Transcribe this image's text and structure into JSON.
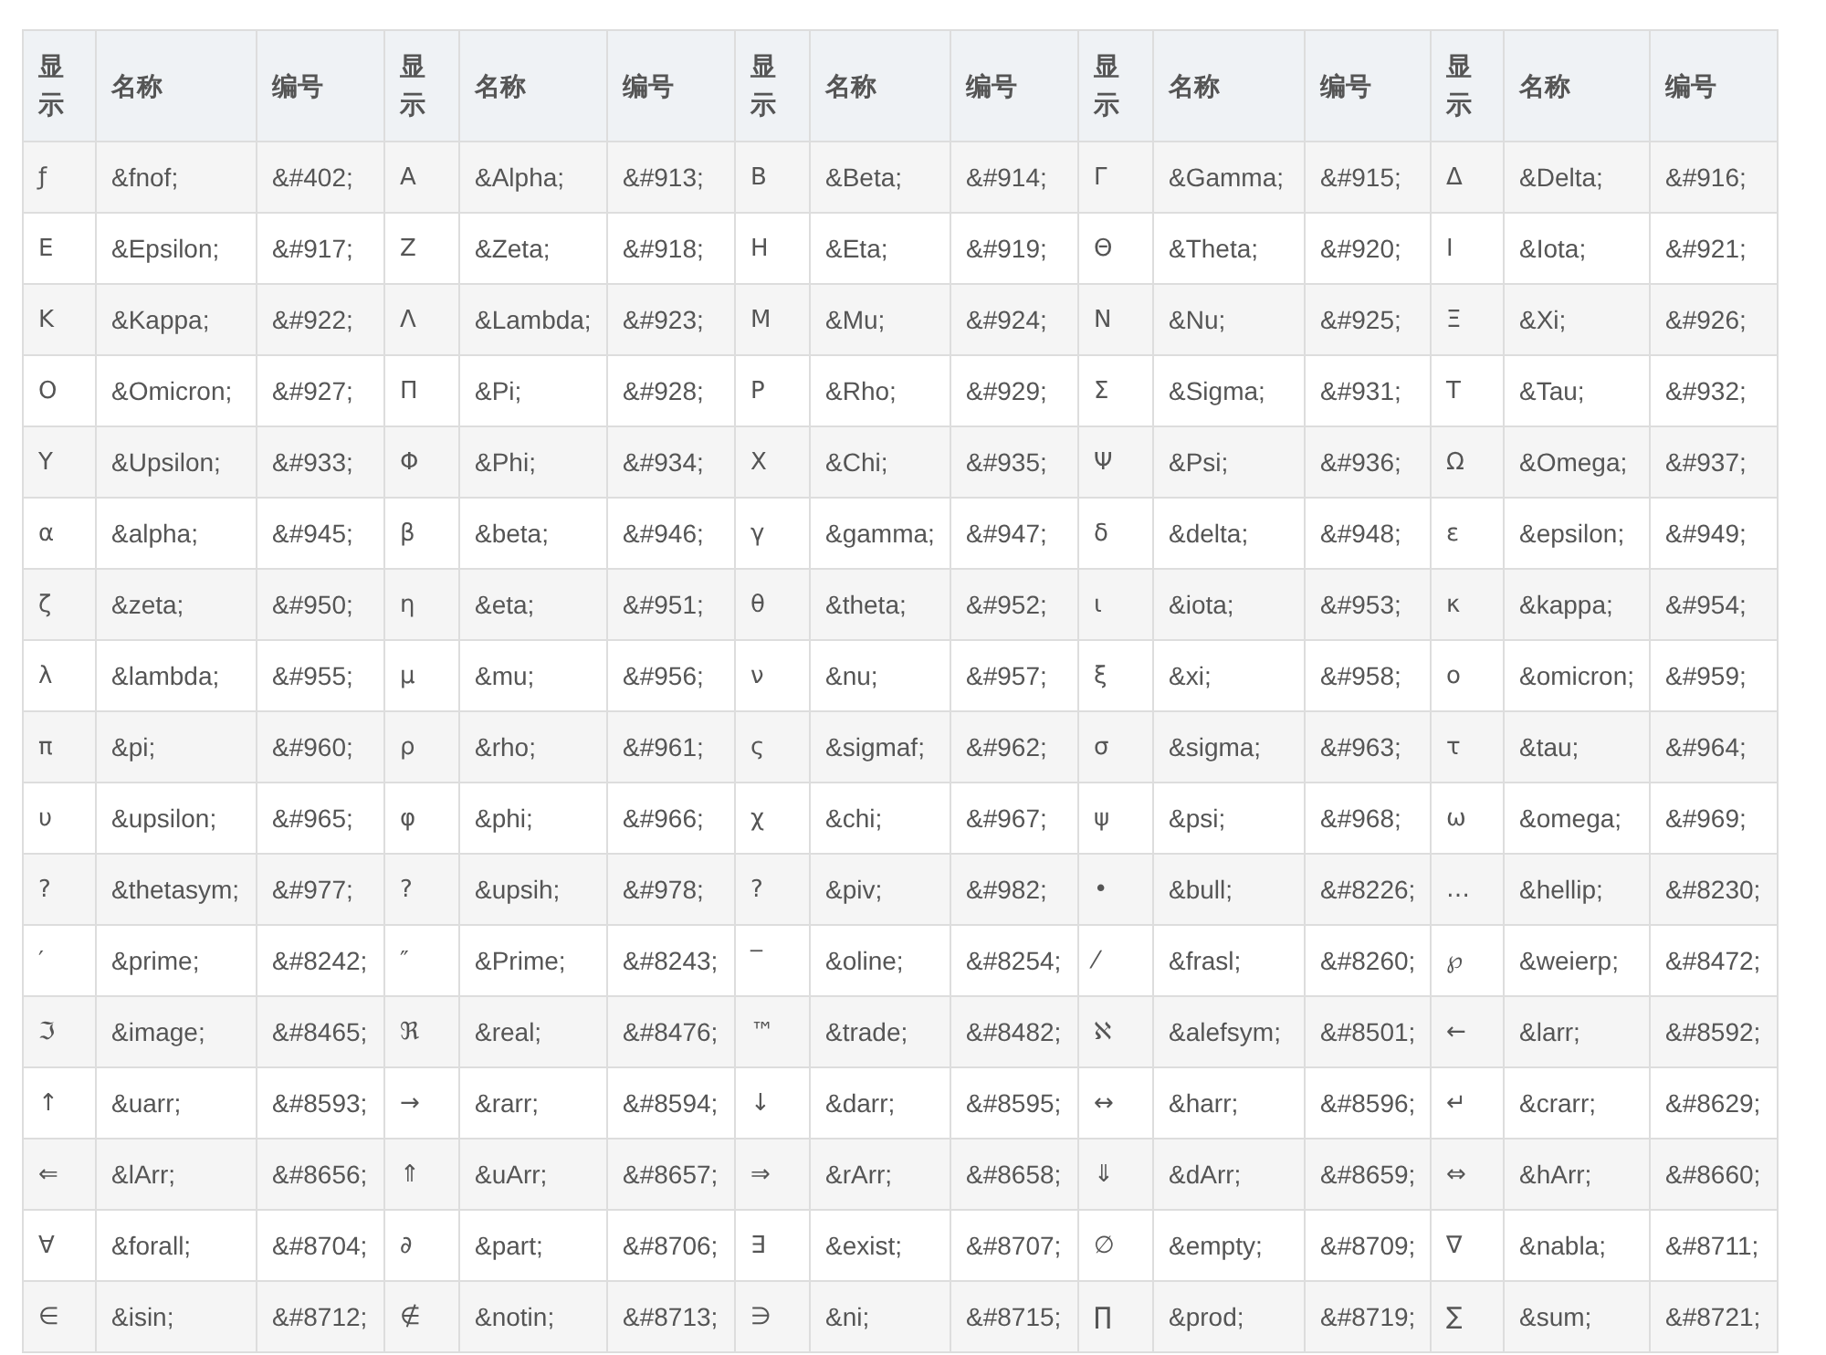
{
  "table": {
    "columns": [
      "显示",
      "名称",
      "编号",
      "显示",
      "名称",
      "编号",
      "显示",
      "名称",
      "编号",
      "显示",
      "名称",
      "编号",
      "显示",
      "名称",
      "编号"
    ],
    "rows": [
      [
        "ƒ",
        "&fnof;",
        "&#402;",
        "Α",
        "&Alpha;",
        "&#913;",
        "Β",
        "&Beta;",
        "&#914;",
        "Γ",
        "&Gamma;",
        "&#915;",
        "Δ",
        "&Delta;",
        "&#916;"
      ],
      [
        "Ε",
        "&Epsilon;",
        "&#917;",
        "Ζ",
        "&Zeta;",
        "&#918;",
        "Η",
        "&Eta;",
        "&#919;",
        "Θ",
        "&Theta;",
        "&#920;",
        "Ι",
        "&Iota;",
        "&#921;"
      ],
      [
        "Κ",
        "&Kappa;",
        "&#922;",
        "Λ",
        "&Lambda;",
        "&#923;",
        "Μ",
        "&Mu;",
        "&#924;",
        "Ν",
        "&Nu;",
        "&#925;",
        "Ξ",
        "&Xi;",
        "&#926;"
      ],
      [
        "Ο",
        "&Omicron;",
        "&#927;",
        "Π",
        "&Pi;",
        "&#928;",
        "Ρ",
        "&Rho;",
        "&#929;",
        "Σ",
        "&Sigma;",
        "&#931;",
        "Τ",
        "&Tau;",
        "&#932;"
      ],
      [
        "Υ",
        "&Upsilon;",
        "&#933;",
        "Φ",
        "&Phi;",
        "&#934;",
        "Χ",
        "&Chi;",
        "&#935;",
        "Ψ",
        "&Psi;",
        "&#936;",
        "Ω",
        "&Omega;",
        "&#937;"
      ],
      [
        "α",
        "&alpha;",
        "&#945;",
        "β",
        "&beta;",
        "&#946;",
        "γ",
        "&gamma;",
        "&#947;",
        "δ",
        "&delta;",
        "&#948;",
        "ε",
        "&epsilon;",
        "&#949;"
      ],
      [
        "ζ",
        "&zeta;",
        "&#950;",
        "η",
        "&eta;",
        "&#951;",
        "θ",
        "&theta;",
        "&#952;",
        "ι",
        "&iota;",
        "&#953;",
        "κ",
        "&kappa;",
        "&#954;"
      ],
      [
        "λ",
        "&lambda;",
        "&#955;",
        "μ",
        "&mu;",
        "&#956;",
        "ν",
        "&nu;",
        "&#957;",
        "ξ",
        "&xi;",
        "&#958;",
        "ο",
        "&omicron;",
        "&#959;"
      ],
      [
        "π",
        "&pi;",
        "&#960;",
        "ρ",
        "&rho;",
        "&#961;",
        "ς",
        "&sigmaf;",
        "&#962;",
        "σ",
        "&sigma;",
        "&#963;",
        "τ",
        "&tau;",
        "&#964;"
      ],
      [
        "υ",
        "&upsilon;",
        "&#965;",
        "φ",
        "&phi;",
        "&#966;",
        "χ",
        "&chi;",
        "&#967;",
        "ψ",
        "&psi;",
        "&#968;",
        "ω",
        "&omega;",
        "&#969;"
      ],
      [
        "?",
        "&thetasym;",
        "&#977;",
        "?",
        "&upsih;",
        "&#978;",
        "?",
        "&piv;",
        "&#982;",
        "•",
        "&bull;",
        "&#8226;",
        "…",
        "&hellip;",
        "&#8230;"
      ],
      [
        "′",
        "&prime;",
        "&#8242;",
        "″",
        "&Prime;",
        "&#8243;",
        "‾",
        "&oline;",
        "&#8254;",
        "⁄",
        "&frasl;",
        "&#8260;",
        "℘",
        "&weierp;",
        "&#8472;"
      ],
      [
        "ℑ",
        "&image;",
        "&#8465;",
        "ℜ",
        "&real;",
        "&#8476;",
        "™",
        "&trade;",
        "&#8482;",
        "ℵ",
        "&alefsym;",
        "&#8501;",
        "←",
        "&larr;",
        "&#8592;"
      ],
      [
        "↑",
        "&uarr;",
        "&#8593;",
        "→",
        "&rarr;",
        "&#8594;",
        "↓",
        "&darr;",
        "&#8595;",
        "↔",
        "&harr;",
        "&#8596;",
        "↵",
        "&crarr;",
        "&#8629;"
      ],
      [
        "⇐",
        "&lArr;",
        "&#8656;",
        "⇑",
        "&uArr;",
        "&#8657;",
        "⇒",
        "&rArr;",
        "&#8658;",
        "⇓",
        "&dArr;",
        "&#8659;",
        "⇔",
        "&hArr;",
        "&#8660;"
      ],
      [
        "∀",
        "&forall;",
        "&#8704;",
        "∂",
        "&part;",
        "&#8706;",
        "∃",
        "&exist;",
        "&#8707;",
        "∅",
        "&empty;",
        "&#8709;",
        "∇",
        "&nabla;",
        "&#8711;"
      ],
      [
        "∈",
        "&isin;",
        "&#8712;",
        "∉",
        "&notin;",
        "&#8713;",
        "∋",
        "&ni;",
        "&#8715;",
        "∏",
        "&prod;",
        "&#8719;",
        "∑",
        "&sum;",
        "&#8721;"
      ]
    ]
  }
}
